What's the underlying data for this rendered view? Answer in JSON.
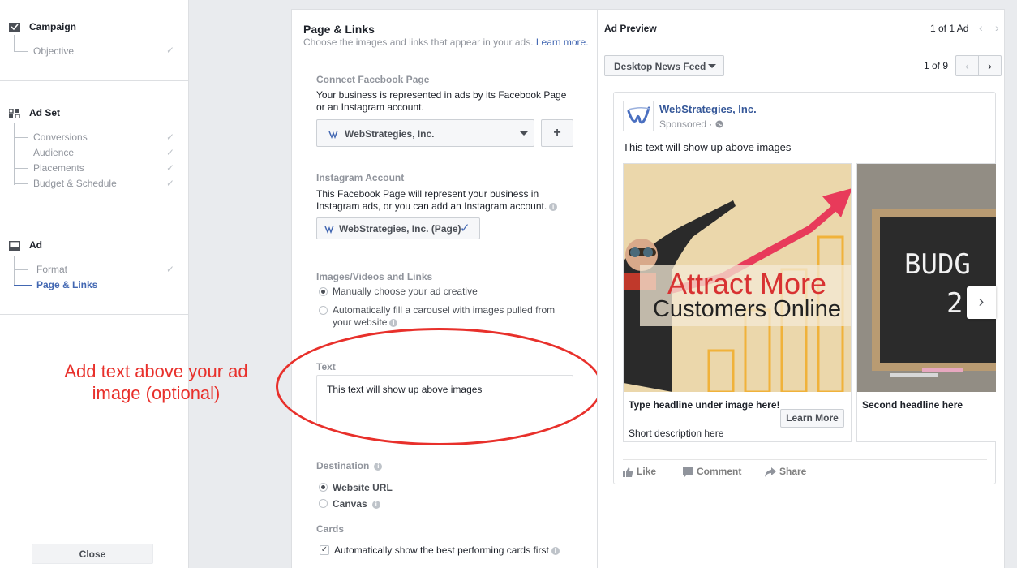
{
  "sidebar": {
    "campaign": {
      "title": "Campaign",
      "items": [
        "Objective"
      ]
    },
    "adset": {
      "title": "Ad Set",
      "items": [
        "Conversions",
        "Audience",
        "Placements",
        "Budget & Schedule"
      ]
    },
    "ad": {
      "title": "Ad",
      "items": [
        "Format",
        "Page & Links"
      ]
    },
    "close_label": "Close"
  },
  "annotation": "Add text above your ad image (optional)",
  "form": {
    "title": "Page & Links",
    "subtitle": "Choose the images and links that appear in your ads.",
    "learn_more": "Learn more.",
    "connect": {
      "label": "Connect Facebook Page",
      "desc": "Your business is represented in ads by its Facebook Page or an Instagram account.",
      "selected": "WebStrategies, Inc.",
      "plus": "+"
    },
    "instagram": {
      "label": "Instagram Account",
      "desc": "This Facebook Page will represent your business in Instagram ads, or you can add an Instagram account.",
      "selected": "WebStrategies, Inc. (Page)"
    },
    "images": {
      "label": "Images/Videos and Links",
      "option1": "Manually choose your ad creative",
      "option2": "Automatically fill a carousel with images pulled from your website"
    },
    "text": {
      "label": "Text",
      "value": "This text will show up above images"
    },
    "destination": {
      "label": "Destination",
      "option1": "Website URL",
      "option2": "Canvas"
    },
    "cards": {
      "label": "Cards",
      "option": "Automatically show the best performing cards first"
    }
  },
  "preview": {
    "title": "Ad Preview",
    "count": "1 of 1 Ad",
    "placement": "Desktop News Feed",
    "pager": "1 of 9",
    "page_name": "WebStrategies, Inc.",
    "sponsored": "Sponsored ·",
    "text": "This text will show up above images",
    "card1": {
      "img_line1": "Attract More",
      "img_line2": "Customers Online",
      "headline": "Type headline under image here!",
      "desc": "Short description here",
      "cta": "Learn More"
    },
    "card2": {
      "img_text1": "BUDG",
      "img_text2": "2",
      "headline": "Second headline here"
    },
    "actions": {
      "like": "Like",
      "comment": "Comment",
      "share": "Share"
    }
  },
  "colors": {
    "accent": "#4267b2",
    "annotation": "#e8302b",
    "link": "#365899"
  }
}
